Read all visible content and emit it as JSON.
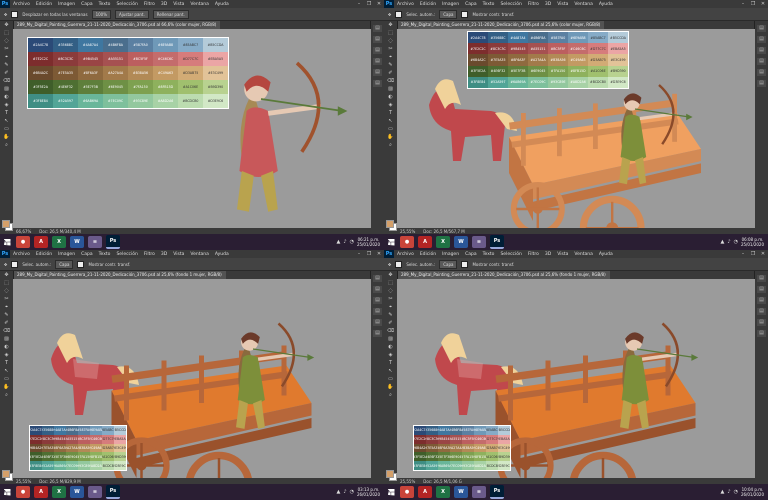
{
  "app": {
    "logo": "Ps",
    "window_controls": [
      "–",
      "❐",
      "✕"
    ]
  },
  "menu": [
    "Archivo",
    "Edición",
    "Imagen",
    "Capa",
    "Texto",
    "Selección",
    "Filtro",
    "3D",
    "Vista",
    "Ventana",
    "Ayuda"
  ],
  "palette_codes": [
    [
      "#2A4C78",
      "#35688C",
      "#4A87A4",
      "#4B6F8A",
      "#587FA0",
      "#6E9AB8",
      "#85ABC7",
      "#B5CCDA"
    ],
    [
      "#7E2C2C",
      "#8C3C3C",
      "#9B4545",
      "#A55151",
      "#BC5F5F",
      "#C46C6C",
      "#D77C7C",
      "#EBA5A5"
    ],
    [
      "#6B4A2C",
      "#7E5A35",
      "#8F6A3F",
      "#A27A4A",
      "#B38A56",
      "#C49A63",
      "#D3AB75",
      "#E3C499"
    ],
    [
      "#3F5E2A",
      "#4E6F32",
      "#5E7F3B",
      "#6E9045",
      "#7FA150",
      "#8FB15D",
      "#A1C06E",
      "#B9D390"
    ],
    [
      "#3F8E84",
      "#52A597",
      "#6AB69A",
      "#7EC09C",
      "#93C89E",
      "#A8D2A6",
      "#BCDCB0",
      "#D3E9C6"
    ]
  ],
  "palette_colors": [
    [
      "#2b4a77",
      "#335f85",
      "#3f77a0",
      "#4a6e8d",
      "#5b80a2",
      "#6f99b8",
      "#86abc7",
      "#b4cbd9"
    ],
    [
      "#7d2d2d",
      "#8b3b3b",
      "#9a4545",
      "#a65151",
      "#bc5f5f",
      "#c46c6c",
      "#d67c7c",
      "#eba5a5"
    ],
    [
      "#6a4a2d",
      "#7d5a35",
      "#8f6a3f",
      "#a27a4a",
      "#b28a56",
      "#c39a63",
      "#d2ab75",
      "#e2c398"
    ],
    [
      "#3f5e2a",
      "#4e6f32",
      "#5e7f3b",
      "#6e9045",
      "#7ea150",
      "#8eb15d",
      "#a0c06e",
      "#b8d290"
    ],
    [
      "#3f8e84",
      "#52a597",
      "#69b69a",
      "#7ec09c",
      "#93c89e",
      "#a8d2a6",
      "#bcdcb0",
      "#d2e8c6"
    ]
  ],
  "windows": [
    {
      "tool_options": {
        "check_label": "Desplazar en todas las ventanas",
        "zoom": "100%",
        "fit_button": "Ajustar pant.",
        "fill_button": "Rellenar pant."
      },
      "doc_title": "289_My_Digital_Painting_Guerrera_21-11-2020_Dedicación_3706.psd al 66,6% (color mujer, RGB/8)",
      "status": {
        "zoom": "66,67%",
        "doc": "Doc: 26,5 M/340,4 M"
      },
      "taskbar": {
        "time": "06:21 p.m.",
        "date": "25/01/2020"
      }
    },
    {
      "tool_options": {
        "check_label": "Selec. autom.:",
        "mode": "Capa",
        "transform_label": "Mostrar contr. transf."
      },
      "doc_title": "289_My_Digital_Painting_Guerrera_21-11-2020_Dedicación_3706.psd al 25,6% (color mujer, RGB/8)",
      "status": {
        "zoom": "25,55%",
        "doc": "Doc: 26,5 M/567,7 M"
      },
      "taskbar": {
        "time": "06:08 p.m.",
        "date": "25/01/2020"
      }
    },
    {
      "tool_options": {
        "check_label": "Selec. autom.:",
        "mode": "Capa",
        "transform_label": "Mostrar contr. transf."
      },
      "doc_title": "289_My_Digital_Painting_Guerrera_21-11-2020_Dedicación_3706.psd al 25,6% (fondo 1 mujer, RGB/8)",
      "status": {
        "zoom": "25,55%",
        "doc": "Doc: 26,5 M/829,9 M"
      },
      "taskbar": {
        "time": "03:13 p.m.",
        "date": "26/01/2020"
      }
    },
    {
      "tool_options": {
        "check_label": "Selec. autom.:",
        "mode": "Capa",
        "transform_label": "Mostrar contr. transf."
      },
      "doc_title": "289_My_Digital_Painting_Guerrera_21-11-2020_Dedicación_3706.psd al 25,6% (fondo 1 mujer, RGB/8)",
      "status": {
        "zoom": "25,55%",
        "doc": "Doc: 26,5 M/1,06 G"
      },
      "taskbar": {
        "time": "10:04 p.m.",
        "date": "26/01/2020"
      }
    }
  ],
  "taskbar_apps": [
    {
      "name": "chrome",
      "glyph": "●",
      "color": "#c9443a"
    },
    {
      "name": "acrobat",
      "glyph": "A",
      "color": "#b32424"
    },
    {
      "name": "excel",
      "glyph": "X",
      "color": "#1f7244"
    },
    {
      "name": "word",
      "glyph": "W",
      "color": "#2a5699"
    },
    {
      "name": "notes",
      "glyph": "≡",
      "color": "#6a5a8a"
    },
    {
      "name": "photoshop",
      "glyph": "Ps",
      "color": "#001e36"
    }
  ],
  "colors": {
    "canvas_bg": "#9b9b9b",
    "ps_chrome": "#3a3a3a",
    "taskbar": "#2a1e33"
  }
}
